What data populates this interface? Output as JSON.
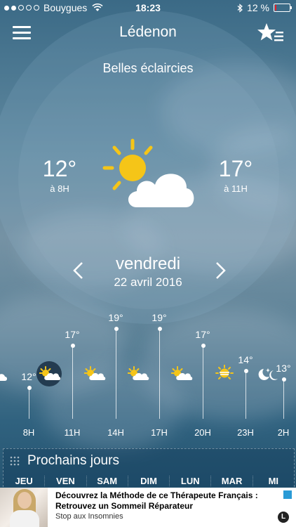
{
  "status_bar": {
    "carrier": "Bouygues",
    "time": "18:23",
    "battery": "12 %",
    "battery_level": 0.12
  },
  "header": {
    "city": "Lédenon",
    "menu_icon": "hamburger-menu-icon",
    "favorite_icon": "star-list-icon"
  },
  "today": {
    "condition": "Belles éclaircies",
    "icon": "sun-cloud-icon",
    "min": {
      "temp": "12°",
      "label": "à 8H"
    },
    "max": {
      "temp": "17°",
      "label": "à 11H"
    }
  },
  "day_nav": {
    "day": "vendredi",
    "date": "22 avril 2016",
    "prev_icon": "chevron-left-icon",
    "next_icon": "chevron-right-icon"
  },
  "hourly": [
    {
      "hour": "8H",
      "temp": "12°",
      "temp_value": 12,
      "icon": "sun-cloud-icon",
      "selected": true
    },
    {
      "hour": "11H",
      "temp": "17°",
      "temp_value": 17,
      "icon": "sun-cloud-icon"
    },
    {
      "hour": "14H",
      "temp": "19°",
      "temp_value": 19,
      "icon": "sun-cloud-icon"
    },
    {
      "hour": "17H",
      "temp": "19°",
      "temp_value": 19,
      "icon": "sun-cloud-icon"
    },
    {
      "hour": "20H",
      "temp": "17°",
      "temp_value": 17,
      "icon": "sun-haze-icon"
    },
    {
      "hour": "23H",
      "temp": "14°",
      "temp_value": 14,
      "icon": "moon-star-icon"
    },
    {
      "hour": "2H",
      "temp": "13°",
      "temp_value": 13,
      "icon": "moon-icon"
    }
  ],
  "next_days": {
    "title": "Prochains jours",
    "icon": "grid-dots-icon",
    "days": [
      "JEU",
      "VEN",
      "SAM",
      "DIM",
      "LUN",
      "MAR",
      "MI"
    ]
  },
  "ad": {
    "line1": "Découvrez la Méthode de ce Thérapeute Français :",
    "line2": "Retrouvez un Sommeil Réparateur",
    "line3": "Stop aux Insomnies",
    "logo": "L",
    "info_icon": "adchoices-icon"
  },
  "colors": {
    "accent_sun": "#f5c518",
    "battery_low": "#e8202a"
  }
}
